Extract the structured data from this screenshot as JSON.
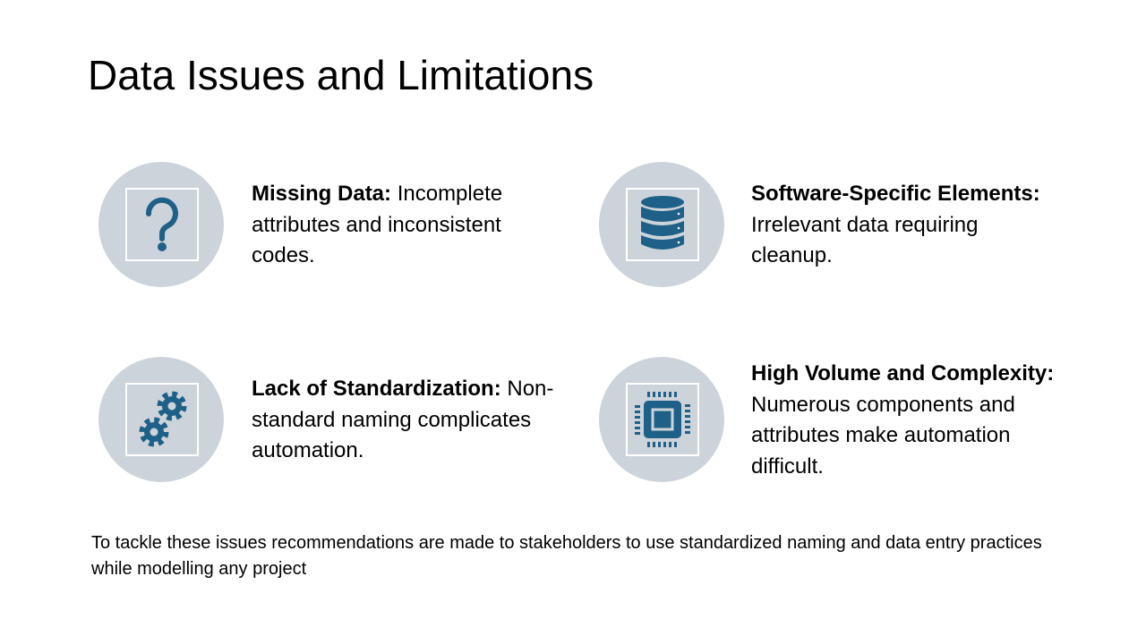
{
  "title": "Data Issues and Limitations",
  "colors": {
    "circle": "#cdd3da",
    "icon": "#1e6087"
  },
  "items": [
    {
      "icon": "question-icon",
      "heading": "Missing Data:",
      "text": " Incomplete attributes and inconsistent codes."
    },
    {
      "icon": "database-icon",
      "heading": "Software-Specific Elements:",
      "text": " Irrelevant data requiring cleanup."
    },
    {
      "icon": "gears-icon",
      "heading": "Lack of Standardization:",
      "text": " Non-standard naming complicates automation."
    },
    {
      "icon": "processor-icon",
      "heading": "High Volume and Complexity:",
      "text": " Numerous components and attributes make automation difficult."
    }
  ],
  "footer": "To tackle these issues recommendations are made to stakeholders to use standardized naming and data entry practices while modelling any project"
}
